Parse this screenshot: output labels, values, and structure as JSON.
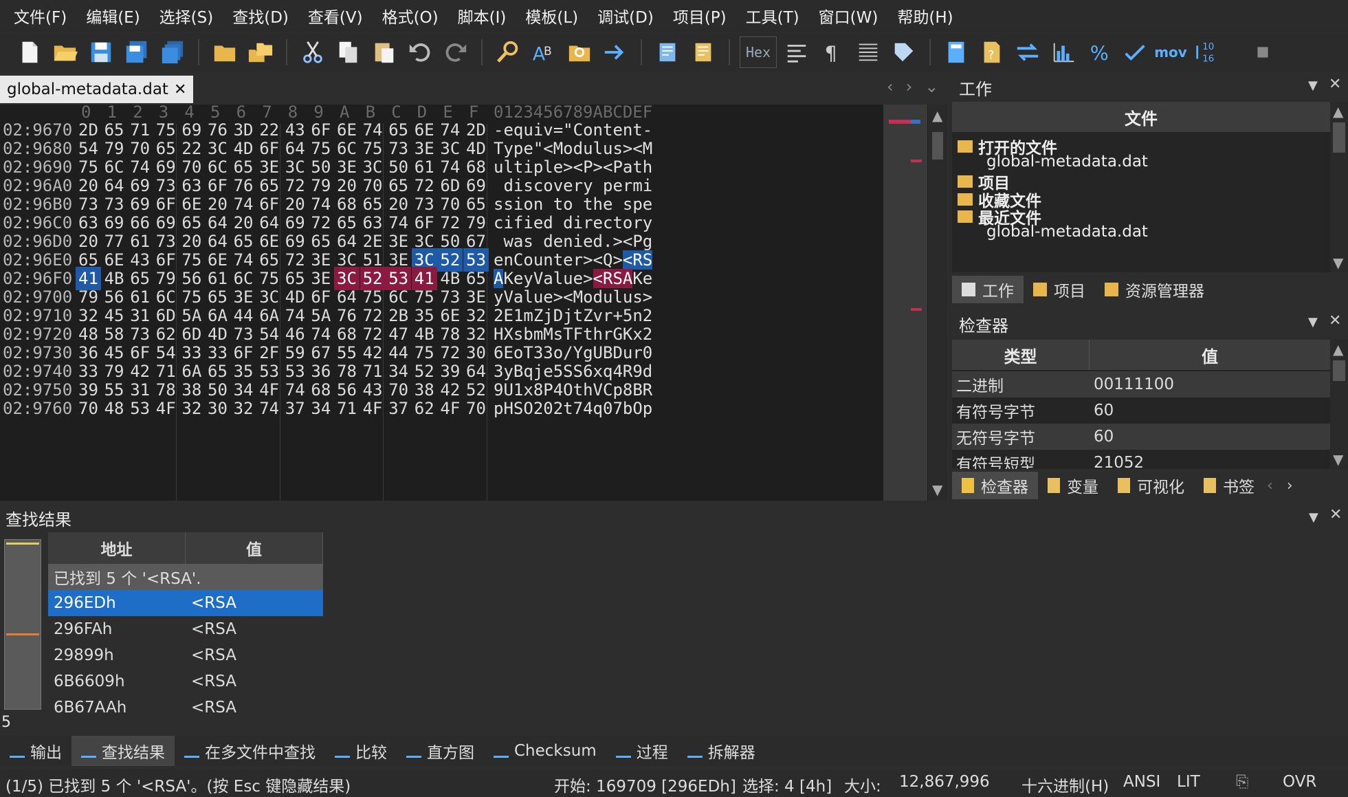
{
  "menu": [
    "文件(F)",
    "编辑(E)",
    "选择(S)",
    "查找(D)",
    "查看(V)",
    "格式(O)",
    "脚本(I)",
    "模板(L)",
    "调试(D)",
    "项目(P)",
    "工具(T)",
    "窗口(W)",
    "帮助(H)"
  ],
  "toolbar": {
    "hex_label": "Hex",
    "mov_label": "mov"
  },
  "tab": {
    "title": "global-metadata.dat",
    "close": "✕"
  },
  "hex": {
    "col_headers": [
      "0",
      "1",
      "2",
      "3",
      "4",
      "5",
      "6",
      "7",
      "8",
      "9",
      "A",
      "B",
      "C",
      "D",
      "E",
      "F"
    ],
    "ascii_header": "0123456789ABCDEF",
    "rows": [
      {
        "addr": "02:9670",
        "bytes": [
          "2D",
          "65",
          "71",
          "75",
          "69",
          "76",
          "3D",
          "22",
          "43",
          "6F",
          "6E",
          "74",
          "65",
          "6E",
          "74",
          "2D"
        ],
        "ascii": "-equiv=\"Content-"
      },
      {
        "addr": "02:9680",
        "bytes": [
          "54",
          "79",
          "70",
          "65",
          "22",
          "3C",
          "4D",
          "6F",
          "64",
          "75",
          "6C",
          "75",
          "73",
          "3E",
          "3C",
          "4D"
        ],
        "ascii": "Type\"<Modulus><M"
      },
      {
        "addr": "02:9690",
        "bytes": [
          "75",
          "6C",
          "74",
          "69",
          "70",
          "6C",
          "65",
          "3E",
          "3C",
          "50",
          "3E",
          "3C",
          "50",
          "61",
          "74",
          "68"
        ],
        "ascii": "ultiple><P><Path"
      },
      {
        "addr": "02:96A0",
        "bytes": [
          "20",
          "64",
          "69",
          "73",
          "63",
          "6F",
          "76",
          "65",
          "72",
          "79",
          "20",
          "70",
          "65",
          "72",
          "6D",
          "69"
        ],
        "ascii": " discovery permi"
      },
      {
        "addr": "02:96B0",
        "bytes": [
          "73",
          "73",
          "69",
          "6F",
          "6E",
          "20",
          "74",
          "6F",
          "20",
          "74",
          "68",
          "65",
          "20",
          "73",
          "70",
          "65"
        ],
        "ascii": "ssion to the spe"
      },
      {
        "addr": "02:96C0",
        "bytes": [
          "63",
          "69",
          "66",
          "69",
          "65",
          "64",
          "20",
          "64",
          "69",
          "72",
          "65",
          "63",
          "74",
          "6F",
          "72",
          "79"
        ],
        "ascii": "cified directory"
      },
      {
        "addr": "02:96D0",
        "bytes": [
          "20",
          "77",
          "61",
          "73",
          "20",
          "64",
          "65",
          "6E",
          "69",
          "65",
          "64",
          "2E",
          "3E",
          "3C",
          "50",
          "67"
        ],
        "ascii": " was denied.><Pg"
      },
      {
        "addr": "02:96E0",
        "bytes": [
          "65",
          "6E",
          "43",
          "6F",
          "75",
          "6E",
          "74",
          "65",
          "72",
          "3E",
          "3C",
          "51",
          "3E",
          "3C",
          "52",
          "53"
        ],
        "ascii": "enCounter><Q><RS"
      },
      {
        "addr": "02:96F0",
        "bytes": [
          "41",
          "4B",
          "65",
          "79",
          "56",
          "61",
          "6C",
          "75",
          "65",
          "3E",
          "3C",
          "52",
          "53",
          "41",
          "4B",
          "65"
        ],
        "ascii": "AKeyValue><RSAKe"
      },
      {
        "addr": "02:9700",
        "bytes": [
          "79",
          "56",
          "61",
          "6C",
          "75",
          "65",
          "3E",
          "3C",
          "4D",
          "6F",
          "64",
          "75",
          "6C",
          "75",
          "73",
          "3E"
        ],
        "ascii": "yValue><Modulus>"
      },
      {
        "addr": "02:9710",
        "bytes": [
          "32",
          "45",
          "31",
          "6D",
          "5A",
          "6A",
          "44",
          "6A",
          "74",
          "5A",
          "76",
          "72",
          "2B",
          "35",
          "6E",
          "32"
        ],
        "ascii": "2E1mZjDjtZvr+5n2"
      },
      {
        "addr": "02:9720",
        "bytes": [
          "48",
          "58",
          "73",
          "62",
          "6D",
          "4D",
          "73",
          "54",
          "46",
          "74",
          "68",
          "72",
          "47",
          "4B",
          "78",
          "32"
        ],
        "ascii": "HXsbmMsTFthrGKx2"
      },
      {
        "addr": "02:9730",
        "bytes": [
          "36",
          "45",
          "6F",
          "54",
          "33",
          "33",
          "6F",
          "2F",
          "59",
          "67",
          "55",
          "42",
          "44",
          "75",
          "72",
          "30"
        ],
        "ascii": "6EoT33o/YgUBDur0"
      },
      {
        "addr": "02:9740",
        "bytes": [
          "33",
          "79",
          "42",
          "71",
          "6A",
          "65",
          "35",
          "53",
          "53",
          "36",
          "78",
          "71",
          "34",
          "52",
          "39",
          "64"
        ],
        "ascii": "3yBqje5SS6xq4R9d"
      },
      {
        "addr": "02:9750",
        "bytes": [
          "39",
          "55",
          "31",
          "78",
          "38",
          "50",
          "34",
          "4F",
          "74",
          "68",
          "56",
          "43",
          "70",
          "38",
          "42",
          "52"
        ],
        "ascii": "9U1x8P4OthVCp8BR"
      },
      {
        "addr": "02:9760",
        "bytes": [
          "70",
          "48",
          "53",
          "4F",
          "32",
          "30",
          "32",
          "74",
          "37",
          "34",
          "71",
          "4F",
          "37",
          "62",
          "4F",
          "70"
        ],
        "ascii": "pHSO202t74q07bOp"
      }
    ]
  },
  "work": {
    "title": "工作",
    "files_header": "文件",
    "tree": [
      {
        "label": "打开的文件",
        "bold": true
      },
      {
        "label": "global-metadata.dat",
        "bold": false
      },
      {
        "label": "项目",
        "bold": true
      },
      {
        "label": "收藏文件",
        "bold": true
      },
      {
        "label": "最近文件",
        "bold": true
      },
      {
        "label": "global-metadata.dat",
        "bold": false
      }
    ],
    "tabs": [
      "工作",
      "项目",
      "资源管理器"
    ]
  },
  "inspector": {
    "title": "检查器",
    "col_type": "类型",
    "col_value": "值",
    "rows": [
      {
        "k": "二进制",
        "v": "00111100"
      },
      {
        "k": "有符号字节",
        "v": "60"
      },
      {
        "k": "无符号字节",
        "v": "60"
      },
      {
        "k": "有符号短型",
        "v": "21052"
      }
    ],
    "tabs": [
      "检查器",
      "变量",
      "可视化",
      "书签"
    ]
  },
  "find": {
    "title": "查找结果",
    "col_addr": "地址",
    "col_value": "值",
    "summary": "已找到 5 个 '<RSA'.",
    "count": "5",
    "results": [
      {
        "addr": "296EDh",
        "value": "<RSA",
        "selected": true
      },
      {
        "addr": "296FAh",
        "value": "<RSA",
        "selected": false
      },
      {
        "addr": "29899h",
        "value": "<RSA",
        "selected": false
      },
      {
        "addr": "6B6609h",
        "value": "<RSA",
        "selected": false
      },
      {
        "addr": "6B67AAh",
        "value": "<RSA",
        "selected": false
      }
    ]
  },
  "bottom_tabs": [
    "输出",
    "查找结果",
    "在多文件中查找",
    "比较",
    "直方图",
    "Checksum",
    "过程",
    "拆解器"
  ],
  "status": {
    "message": "(1/5) 已找到 5 个 '<RSA'。(按 Esc 键隐藏结果)",
    "start": "开始: 169709 [296EDh]",
    "selection": "选择: 4 [4h]",
    "size_label": "大小:",
    "size": "12,867,996",
    "mode": "十六进制(H)",
    "encoding": "ANSI",
    "endian": "LIT",
    "ovr": "OVR"
  },
  "colors": {
    "selection_blue": "#1e5aa8",
    "highlight_red": "#8a1a40",
    "accent": "#5ab0ff"
  }
}
